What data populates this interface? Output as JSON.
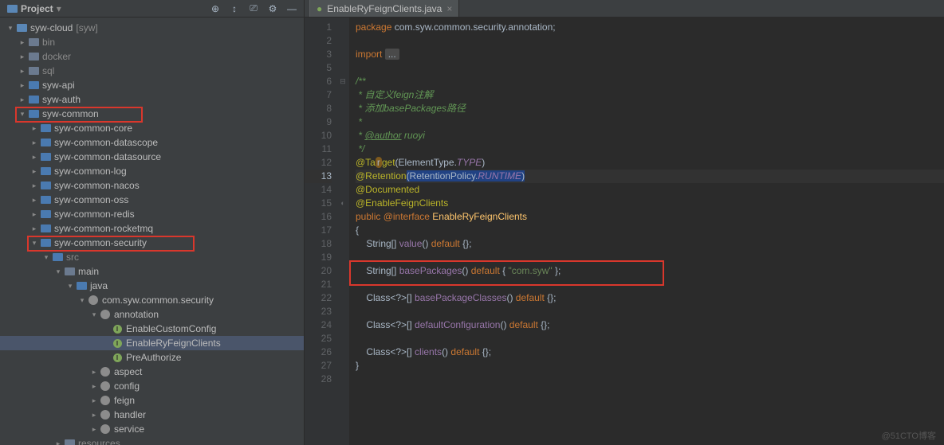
{
  "panel": {
    "title": "Project"
  },
  "toolicons": {
    "target": "⊕",
    "sort": "↕",
    "split": "⎚",
    "gear": "⚙",
    "collapse": "—"
  },
  "tree": [
    {
      "d": 0,
      "a": "open",
      "i": "root",
      "t": "syw-cloud",
      "tag": "[syw]"
    },
    {
      "d": 1,
      "a": "closed",
      "i": "folder",
      "t": "bin",
      "mut": true
    },
    {
      "d": 1,
      "a": "closed",
      "i": "folder",
      "t": "docker",
      "mut": true
    },
    {
      "d": 1,
      "a": "closed",
      "i": "folder",
      "t": "sql",
      "mut": true
    },
    {
      "d": 1,
      "a": "closed",
      "i": "src",
      "t": "syw-api"
    },
    {
      "d": 1,
      "a": "closed",
      "i": "src",
      "t": "syw-auth"
    },
    {
      "d": 1,
      "a": "open",
      "i": "src",
      "t": "syw-common",
      "hi": 1
    },
    {
      "d": 2,
      "a": "closed",
      "i": "src",
      "t": "syw-common-core"
    },
    {
      "d": 2,
      "a": "closed",
      "i": "src",
      "t": "syw-common-datascope"
    },
    {
      "d": 2,
      "a": "closed",
      "i": "src",
      "t": "syw-common-datasource"
    },
    {
      "d": 2,
      "a": "closed",
      "i": "src",
      "t": "syw-common-log"
    },
    {
      "d": 2,
      "a": "closed",
      "i": "src",
      "t": "syw-common-nacos"
    },
    {
      "d": 2,
      "a": "closed",
      "i": "src",
      "t": "syw-common-oss"
    },
    {
      "d": 2,
      "a": "closed",
      "i": "src",
      "t": "syw-common-redis"
    },
    {
      "d": 2,
      "a": "closed",
      "i": "src",
      "t": "syw-common-rocketmq"
    },
    {
      "d": 2,
      "a": "open",
      "i": "src",
      "t": "syw-common-security",
      "hi": 2
    },
    {
      "d": 3,
      "a": "open",
      "i": "src",
      "t": "src",
      "mut": true
    },
    {
      "d": 4,
      "a": "open",
      "i": "folder",
      "t": "main"
    },
    {
      "d": 5,
      "a": "open",
      "i": "src",
      "t": "java"
    },
    {
      "d": 6,
      "a": "open",
      "i": "pkg",
      "t": "com.syw.common.security"
    },
    {
      "d": 7,
      "a": "open",
      "i": "pkg",
      "t": "annotation"
    },
    {
      "d": 8,
      "a": "none",
      "i": "java",
      "t": "EnableCustomConfig"
    },
    {
      "d": 8,
      "a": "none",
      "i": "java",
      "t": "EnableRyFeignClients",
      "sel": true
    },
    {
      "d": 8,
      "a": "none",
      "i": "java",
      "t": "PreAuthorize"
    },
    {
      "d": 7,
      "a": "closed",
      "i": "pkg",
      "t": "aspect"
    },
    {
      "d": 7,
      "a": "closed",
      "i": "pkg",
      "t": "config"
    },
    {
      "d": 7,
      "a": "closed",
      "i": "pkg",
      "t": "feign"
    },
    {
      "d": 7,
      "a": "closed",
      "i": "pkg",
      "t": "handler"
    },
    {
      "d": 7,
      "a": "closed",
      "i": "pkg",
      "t": "service"
    },
    {
      "d": 4,
      "a": "closed",
      "i": "folder",
      "t": "resources",
      "mut": true
    }
  ],
  "tab": {
    "name": "EnableRyFeignClients.java",
    "icon": "●"
  },
  "code": {
    "pkg_line": "package com.syw.common.security.annotation;",
    "import": "import ",
    "ellipsis": "...",
    "c1": "/**",
    "c2": " * 自定义feign注解",
    "c3": " * 添加basePackages路径",
    "c4": " *",
    "c5_pre": " * ",
    "c5_tag": "@author",
    "c5_post": " ruoyi",
    "c6": " */",
    "a1": "@Target",
    "a1b": "(ElementType.",
    "a1c": "TYPE",
    "a1d": ")",
    "a2": "@Retention",
    "a2b": "(RetentionPolicy.",
    "a2c": "RUNTIME",
    "a2d": ")",
    "a3": "@Documented",
    "a4": "@EnableFeignClients",
    "decl_pre": "public ",
    "decl_at": "@interface ",
    "decl_name": "EnableRyFeignClients",
    "brO": "{",
    "brC": "}",
    "m1a": "    String[] ",
    "m1b": "value",
    "m1c": "() ",
    "m1d": "default",
    "m1e": " {};",
    "m2a": "    String[] ",
    "m2b": "basePackages",
    "m2c": "() ",
    "m2d": "default",
    "m2e": " { ",
    "m2f": "\"com.syw\"",
    "m2g": " };",
    "m3a": "    Class<?>[] ",
    "m3b": "basePackageClasses",
    "m3c": "() ",
    "m3d": "default",
    "m3e": " {};",
    "m4a": "    Class<?>[] ",
    "m4b": "defaultConfiguration",
    "m4c": "() ",
    "m4d": "default",
    "m4e": " {};",
    "m5a": "    Class<?>[] ",
    "m5b": "clients",
    "m5c": "() ",
    "m5d": "default",
    "m5e": " {};"
  },
  "watermark": "@51CTO博客"
}
